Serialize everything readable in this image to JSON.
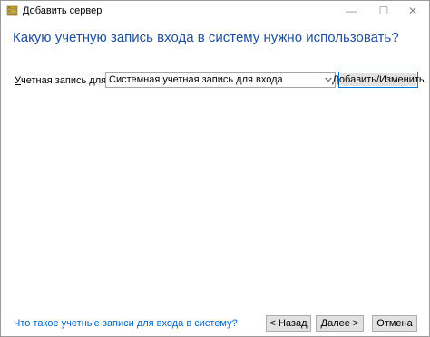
{
  "window": {
    "title": "Добавить сервер",
    "min_glyph": "—",
    "max_glyph": "☐",
    "close_glyph": "✕"
  },
  "main": {
    "heading": "Какую учетную запись входа в систему нужно использовать?",
    "account_label_prefix": "У",
    "account_label_rest": "четная запись для входа:",
    "account_select_value": "Системная учетная запись для входа",
    "add_change_button": "Добавить/Изменить"
  },
  "footer": {
    "help_link": "Что такое учетные записи для входа в систему?",
    "back_button": "< Назад",
    "next_button": "Далее >",
    "cancel_button": "Отмена"
  },
  "colors": {
    "heading": "#1e4f9e",
    "link": "#0066cc",
    "focus_border": "#0078d7"
  },
  "icons": {
    "app": "server-app-icon",
    "dropdown": "chevron-down-icon"
  }
}
